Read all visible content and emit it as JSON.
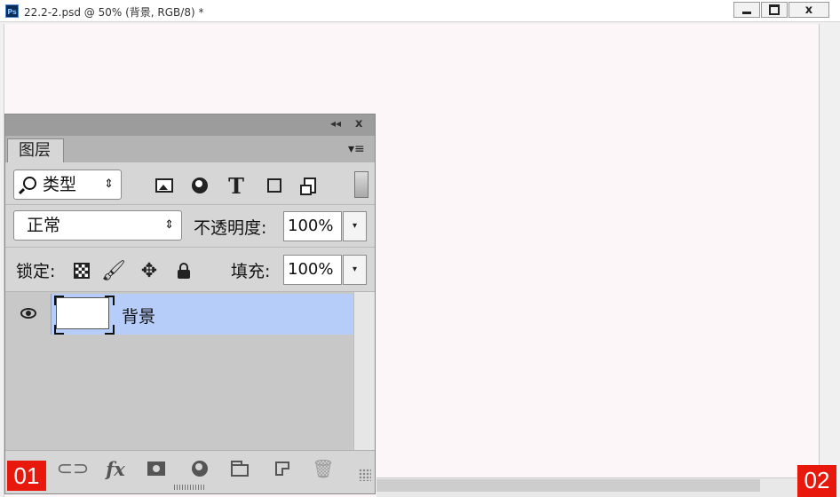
{
  "window": {
    "app_icon_text": "Ps",
    "title": "22.2-2.psd @ 50% (背景, RGB/8) *",
    "close_label": "x"
  },
  "layers_panel": {
    "collapse_glyph": "◂◂",
    "close_glyph": "x",
    "tab_label": "图层",
    "menu_glyph": "▾≡",
    "filter": {
      "kind_label": "类型",
      "arrows": "⇕",
      "icons": [
        "image-layer-filter-icon",
        "adjustment-layer-filter-icon",
        "type-layer-filter-icon",
        "shape-layer-filter-icon",
        "smart-object-filter-icon"
      ],
      "type_glyph": "T"
    },
    "blend_mode": {
      "value": "正常",
      "arrows": "⇕"
    },
    "opacity": {
      "label": "不透明度:",
      "value": "100%"
    },
    "lock": {
      "label": "锁定:",
      "icons": [
        "lock-transparent-pixels-icon",
        "lock-image-pixels-icon",
        "lock-position-icon",
        "lock-all-icon"
      ],
      "brush_glyph": "🖌",
      "move_glyph": "✥"
    },
    "fill": {
      "label": "填充:",
      "value": "100%"
    },
    "dropdown_glyph": "▾",
    "layers": [
      {
        "name": "背景",
        "visible": true,
        "selected": true
      }
    ],
    "footer": {
      "link_glyph": "⊂⊃",
      "fx_label": "fx",
      "delete_glyph": "🗑"
    }
  },
  "markers": {
    "left": "01",
    "right": "02"
  },
  "colors": {
    "canvas": "#fcf6f8",
    "selected_layer": "#b7cdf9",
    "marker": "#e8180c",
    "panel_header": "#9c9c9c"
  }
}
